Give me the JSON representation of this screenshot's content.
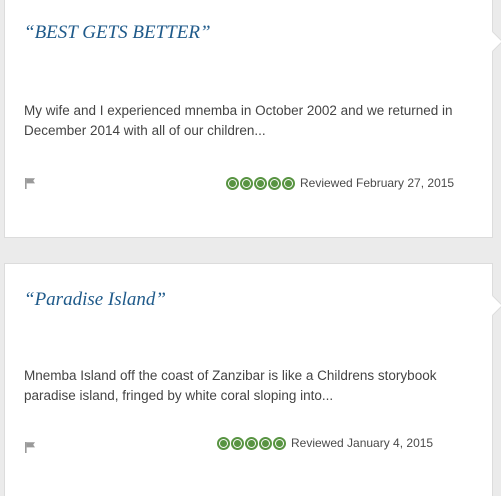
{
  "reviews": [
    {
      "title": "“BEST GETS BETTER”",
      "snippet": "My wife and I experienced mnemba in October 2002 and we returned in December 2014 with all of our children...",
      "rating": 5,
      "reviewed": "Reviewed February 27, 2015"
    },
    {
      "title": "“Paradise Island”",
      "snippet": "Mnemba Island off the coast of Zanzibar is like a Childrens storybook paradise island, fringed by white coral sloping into...",
      "rating": 5,
      "reviewed": "Reviewed January 4, 2015"
    }
  ],
  "colors": {
    "title": "#1f5a8a",
    "bubble": "#589442",
    "text": "#444444",
    "flag": "#9a9a9a"
  },
  "icons": {
    "flag": "flag-icon",
    "rating": "rating-bubble-icon"
  }
}
